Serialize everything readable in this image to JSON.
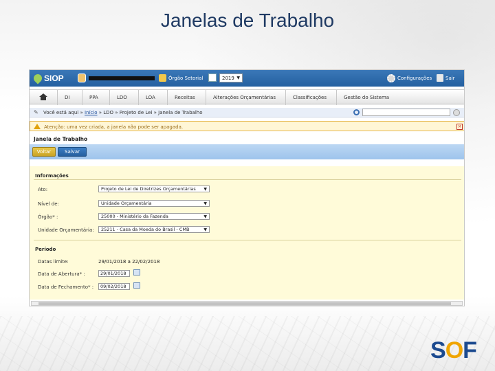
{
  "slide": {
    "title": "Janelas de Trabalho",
    "logo_text": "S",
    "logo_o": "O",
    "logo_f": "F"
  },
  "app": {
    "logo": "SIOP",
    "topbar": {
      "org_label": "Órgão Setorial",
      "year": "2019",
      "config_label": "Configurações",
      "exit_label": "Sair"
    },
    "menu": [
      "DI",
      "PPA",
      "LDO",
      "LOA",
      "Receitas",
      "Alterações Orçamentárias",
      "Classificações",
      "Gestão do Sistema"
    ],
    "breadcrumb": {
      "prefix": "Você está aqui »",
      "home_link": "Início",
      "rest": "» LDO » Projeto de Lei » Janela de Trabalho"
    },
    "alert": "Atenção: uma vez criada, a janela não pode ser apagada.",
    "page_title": "Janela de Trabalho",
    "buttons": {
      "back": "Voltar",
      "save": "Salvar"
    },
    "info_section": {
      "title": "Informações",
      "fields": [
        {
          "label": "Ato:",
          "value": "Projeto de Lei de Diretrizes Orçamentárias"
        },
        {
          "label": "Nível de:",
          "value": "Unidade Orçamentária"
        },
        {
          "label": "Órgão* :",
          "value": "25000 - Ministério da Fazenda"
        },
        {
          "label": "Unidade Orçamentária:",
          "value": "25211 - Casa da Moeda do Brasil - CMB"
        }
      ]
    },
    "period_section": {
      "title": "Período",
      "limit_label": "Datas limite:",
      "limit_value": "29/01/2018 a 22/02/2018",
      "open_label": "Data de Abertura* :",
      "open_value": "29/01/2018",
      "close_label": "Data de Fechamento* :",
      "close_value": "09/02/2018"
    }
  }
}
